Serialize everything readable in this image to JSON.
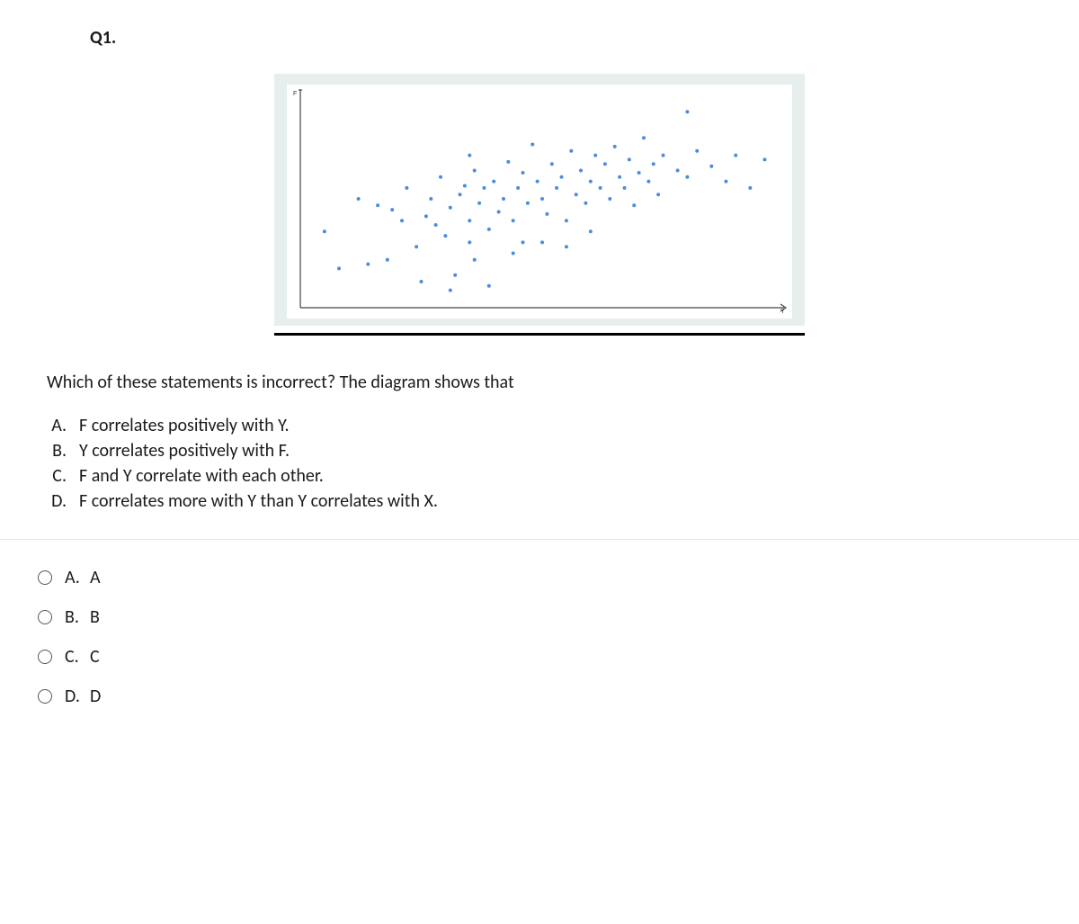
{
  "question_number": "Q1.",
  "prompt": "Which of these statements is incorrect? The diagram shows that",
  "statements": [
    {
      "label": "A.",
      "text": "F correlates positively with Y."
    },
    {
      "label": "B.",
      "text": "Y correlates positively with F."
    },
    {
      "label": "C.",
      "text": "F and Y correlate with each other."
    },
    {
      "label": "D.",
      "text": "F correlates more with Y than Y correlates with X."
    }
  ],
  "options": [
    {
      "label": "A.",
      "text": "A"
    },
    {
      "label": "B.",
      "text": "B"
    },
    {
      "label": "C.",
      "text": "C"
    },
    {
      "label": "D.",
      "text": "D"
    }
  ],
  "chart_data": {
    "type": "scatter",
    "title": "",
    "xlabel": "Y",
    "ylabel": "F",
    "xlim": [
      0,
      100
    ],
    "ylim": [
      0,
      100
    ],
    "points": [
      [
        5,
        35
      ],
      [
        8,
        18
      ],
      [
        12,
        50
      ],
      [
        14,
        20
      ],
      [
        16,
        47
      ],
      [
        18,
        22
      ],
      [
        19,
        45
      ],
      [
        21,
        40
      ],
      [
        22,
        55
      ],
      [
        24,
        28
      ],
      [
        25,
        12
      ],
      [
        26,
        42
      ],
      [
        27,
        50
      ],
      [
        28,
        38
      ],
      [
        29,
        60
      ],
      [
        30,
        33
      ],
      [
        31,
        46
      ],
      [
        32,
        15
      ],
      [
        33,
        52
      ],
      [
        34,
        56
      ],
      [
        35,
        40
      ],
      [
        35,
        30
      ],
      [
        36,
        22
      ],
      [
        36,
        63
      ],
      [
        37,
        48
      ],
      [
        38,
        55
      ],
      [
        39,
        36
      ],
      [
        39,
        10
      ],
      [
        40,
        58
      ],
      [
        41,
        44
      ],
      [
        42,
        50
      ],
      [
        43,
        67
      ],
      [
        44,
        40
      ],
      [
        45,
        55
      ],
      [
        46,
        62
      ],
      [
        46,
        30
      ],
      [
        47,
        48
      ],
      [
        48,
        75
      ],
      [
        49,
        58
      ],
      [
        50,
        50
      ],
      [
        51,
        43
      ],
      [
        52,
        66
      ],
      [
        53,
        55
      ],
      [
        54,
        60
      ],
      [
        55,
        40
      ],
      [
        56,
        72
      ],
      [
        57,
        52
      ],
      [
        58,
        63
      ],
      [
        59,
        48
      ],
      [
        60,
        58
      ],
      [
        61,
        70
      ],
      [
        62,
        55
      ],
      [
        63,
        66
      ],
      [
        64,
        50
      ],
      [
        65,
        74
      ],
      [
        66,
        60
      ],
      [
        67,
        55
      ],
      [
        68,
        68
      ],
      [
        69,
        47
      ],
      [
        70,
        62
      ],
      [
        71,
        78
      ],
      [
        72,
        58
      ],
      [
        73,
        66
      ],
      [
        74,
        52
      ],
      [
        75,
        70
      ],
      [
        78,
        63
      ],
      [
        80,
        60
      ],
      [
        82,
        72
      ],
      [
        85,
        65
      ],
      [
        88,
        58
      ],
      [
        90,
        70
      ],
      [
        93,
        55
      ],
      [
        96,
        68
      ],
      [
        44,
        25
      ],
      [
        50,
        30
      ],
      [
        55,
        28
      ],
      [
        31,
        8
      ],
      [
        60,
        35
      ],
      [
        80,
        90
      ],
      [
        35,
        70
      ]
    ]
  }
}
